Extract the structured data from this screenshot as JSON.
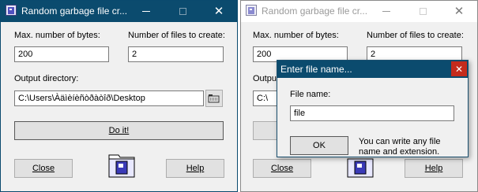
{
  "window": {
    "title": "Random garbage file cr...",
    "max_bytes_label": "Max. number of bytes:",
    "max_bytes_value": "200",
    "num_files_label": "Number of files to create:",
    "num_files_value": "2",
    "output_dir_label": "Output directory:",
    "output_dir_value": "C:\\Users\\Àäìèíèñòðàòîð\\Desktop",
    "do_it_label": "Do it!",
    "close_label": "Close",
    "help_label": "Help"
  },
  "window_right": {
    "max_bytes_label": "Max. number of bytes:",
    "num_files_label": "Number of files to create:",
    "output_dir_label": "Output",
    "output_dir_value": "C:\\",
    "max_bytes_value": "200",
    "num_files_value": "2"
  },
  "dialog": {
    "title": "Enter file name...",
    "field_label": "File name:",
    "field_value": "file",
    "ok_label": "OK",
    "hint": "You can write any file name and extension."
  },
  "colors": {
    "active_title": "#0b4b6e",
    "close_red": "#c42b1c",
    "window_bg": "#f0f0f0"
  }
}
